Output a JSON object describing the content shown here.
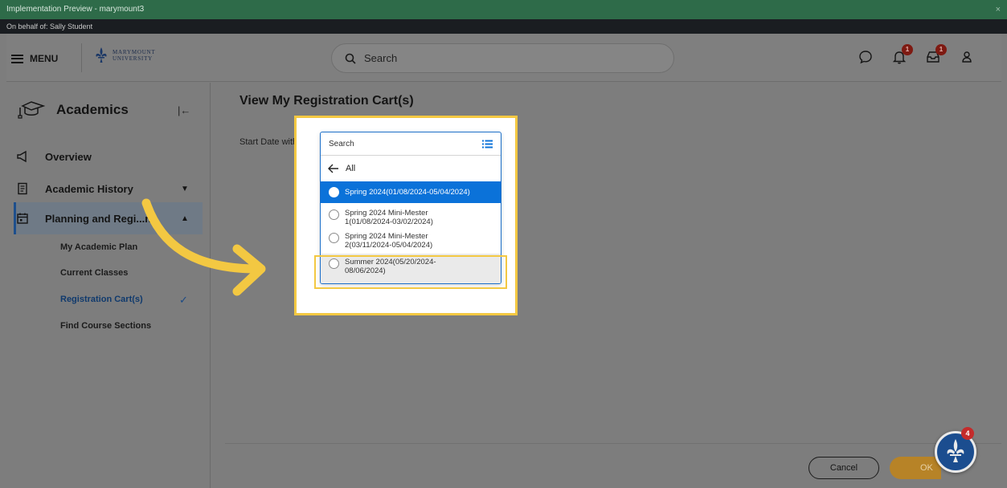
{
  "window": {
    "title": "Implementation Preview - marymount3",
    "close_glyph": "×"
  },
  "behalf": "On behalf of: Sally Student",
  "header": {
    "menu_label": "MENU",
    "logo_line1": "MARYMOUNT",
    "logo_line2": "UNIVERSITY",
    "search_placeholder": "Search",
    "notifications_badge": "1",
    "inbox_badge": "1"
  },
  "sidebar": {
    "title": "Academics",
    "items": [
      {
        "label": "Overview"
      },
      {
        "label": "Academic History"
      },
      {
        "label": "Planning and Regi...r..."
      }
    ],
    "subitems": [
      {
        "label": "My Academic Plan"
      },
      {
        "label": "Current Classes"
      },
      {
        "label": "Registration Cart(s)"
      },
      {
        "label": "Find Course Sections"
      }
    ]
  },
  "main": {
    "title": "View My Registration Cart(s)",
    "field_label": "Start Date within",
    "required_mark": "*"
  },
  "dropdown": {
    "search_placeholder": "Search",
    "back_label": "All",
    "options": [
      {
        "label": "Spring 2024(01/08/2024-05/04/2024)",
        "selected": true
      },
      {
        "label_line1": "Spring 2024 Mini-Mester",
        "label_line2": "1(01/08/2024-03/02/2024)"
      },
      {
        "label_line1": "Spring 2024 Mini-Mester",
        "label_line2": "2(03/11/2024-05/04/2024)"
      },
      {
        "label_line1": "Summer 2024(05/20/2024-",
        "label_line2": "08/06/2024)"
      }
    ]
  },
  "footer": {
    "cancel_label": "Cancel",
    "ok_label": "OK"
  },
  "fab_badge": "4",
  "colors": {
    "accent_blue": "#0b72d9",
    "highlight_yellow": "#f3c842",
    "brand_green": "#2e6b49"
  }
}
